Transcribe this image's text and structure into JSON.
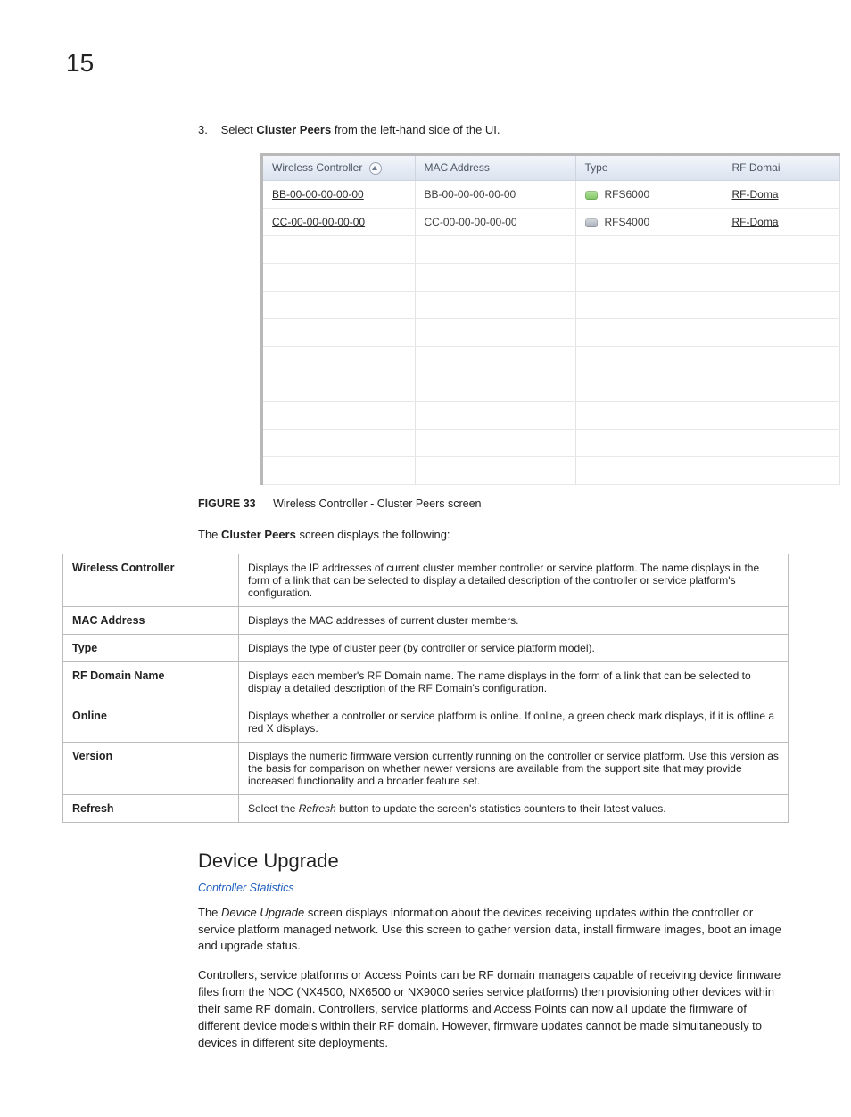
{
  "page_number": "15",
  "instruction": {
    "number": "3.",
    "before": "Select ",
    "bold": "Cluster Peers",
    "after": " from the left-hand side of the UI."
  },
  "grid": {
    "headers": {
      "col1": "Wireless Controller",
      "col2": "MAC Address",
      "col3": "Type",
      "col4": "RF Domai"
    },
    "rows": [
      {
        "controller": "BB-00-00-00-00-00",
        "mac": "BB-00-00-00-00-00",
        "type_icon": "rfs6000",
        "type": "RFS6000",
        "domain": "RF-Doma"
      },
      {
        "controller": "CC-00-00-00-00-00",
        "mac": "CC-00-00-00-00-00",
        "type_icon": "rfs4000",
        "type": "RFS4000",
        "domain": "RF-Doma"
      }
    ]
  },
  "figure_caption": {
    "label": "FIGURE 33",
    "text": "Wireless Controller - Cluster Peers screen"
  },
  "lead_para": {
    "before": "The ",
    "bold": "Cluster Peers",
    "after": " screen displays the following:"
  },
  "definitions": [
    {
      "term": "Wireless Controller",
      "desc": "Displays the IP addresses of current cluster member controller or service platform. The name displays in the form of a link that can be selected to display a detailed description of the controller or service platform's configuration."
    },
    {
      "term": "MAC Address",
      "desc": "Displays the MAC addresses of current cluster members."
    },
    {
      "term": "Type",
      "desc": "Displays the type of cluster peer (by controller or service platform model)."
    },
    {
      "term": "RF Domain Name",
      "desc": "Displays each member's RF Domain name. The name displays in the form of a link that can be selected to display a detailed description of the RF Domain's configuration."
    },
    {
      "term": "Online",
      "desc": "Displays whether a controller or service platform is online. If online, a green check mark displays, if it is offline a red X displays."
    },
    {
      "term": "Version",
      "desc": "Displays the numeric firmware version currently running on the controller or service platform. Use this version as the basis for comparison on whether newer versions are available from the support site that may provide increased functionality and a broader feature set."
    },
    {
      "term": "Refresh",
      "desc_before": "Select the ",
      "desc_italic": "Refresh",
      "desc_after": " button to update the screen's statistics counters to their latest values."
    }
  ],
  "section_heading": "Device Upgrade",
  "breadcrumb": "Controller Statistics",
  "para1": {
    "before": "The ",
    "italic": "Device Upgrade",
    "after": " screen displays information about the devices receiving updates within the controller or service platform managed network. Use this screen to gather version data, install firmware images, boot an image and upgrade status."
  },
  "para2": "Controllers, service platforms or Access Points can be RF domain managers capable of receiving device firmware files from the NOC (NX4500, NX6500 or NX9000 series service platforms) then provisioning other devices within their same RF domain. Controllers, service platforms and Access Points can now all update the firmware of different device models within their RF domain. However, firmware updates cannot be made simultaneously to devices in different site deployments."
}
